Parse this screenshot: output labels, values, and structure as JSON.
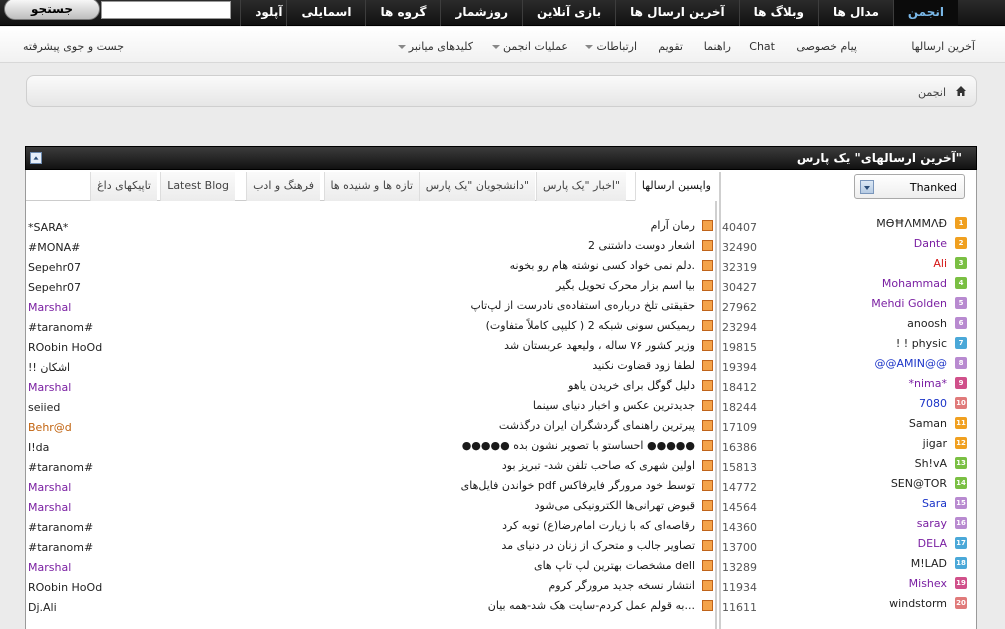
{
  "topbar": {
    "nav": [
      "انجمن",
      "مدال ها",
      "وبلاگ ها",
      "آخرین ارسال ها",
      "بازی آنلاین",
      "روزشمار",
      "گروه ها",
      "اسمایلی",
      "آپلود"
    ],
    "search_value": "",
    "search_button": "جستجو"
  },
  "subnav": {
    "latest_posts": "آخرین ارسالها",
    "private_message": "پیام خصوصی",
    "chat": "Chat",
    "help": "راهنما",
    "calendar": "تقویم",
    "connections": "ارتباطات",
    "forum_actions": "عملیات انجمن",
    "quick_links": "کلیدهای میانبر",
    "advanced_search": "جست و جوی پیشرفته"
  },
  "breadcrumb": {
    "home": "انجمن"
  },
  "widget": {
    "title": "آخرین ارسالهای\" یک پارس\"",
    "tabs": [
      "واپسین ارسالها",
      "اخبار \"یک پارس\"",
      "دانشجویان \"یک پارس\"",
      "تازه ها و شنیده ها",
      "فرهنگ و ادب",
      "Latest Blog",
      "تاپیکهای داغ"
    ],
    "dropdown_value": "Thanked"
  },
  "colors": {
    "purple_user": "#7a1fa2",
    "blue_user": "#1b34c8",
    "red_user": "#d41515",
    "orange_user": "#c1620e"
  },
  "threads": [
    {
      "title": "رمان آرام",
      "author": "*SARA*",
      "author_color": "#222"
    },
    {
      "title": "اشعار دوست داشتنی 2",
      "author": "#MONA#",
      "author_color": "#222"
    },
    {
      "title": "دلم نمی خواد کسی نوشته هام رو بخونه.",
      "author": "Sepehr07",
      "author_color": "#222"
    },
    {
      "title": "بیا اسم بزار محرک تحویل بگیر",
      "author": "Sepehr07",
      "author_color": "#222"
    },
    {
      "title": "حقیقتی تلخ درباره‌ی استفاده‌ی نادرست از لپ‌تاپ",
      "author": "Marshal",
      "author_color": "#7a1fa2"
    },
    {
      "title": "ریمیکس سونی شبکه 2 ( کلیپی کاملاً متفاوت)",
      "author": "#taranom#",
      "author_color": "#222"
    },
    {
      "title": "وزیر کشور ۷۶ ساله ، ولیعهد عربستان شد",
      "author": "ROobin HoOd",
      "author_color": "#222"
    },
    {
      "title": "لطفا زود قضاوت نکنید",
      "author": "!! اشکان",
      "author_color": "#222"
    },
    {
      "title": "دلیل گوگل برای خریدن یاهو",
      "author": "Marshal",
      "author_color": "#7a1fa2"
    },
    {
      "title": "جدیدترین عکس و اخبار دنیای سینما",
      "author": "seiied",
      "author_color": "#222"
    },
    {
      "title": "پیرترین راهنمای گردشگران ایران درگذشت",
      "author": "Behr@d",
      "author_color": "#c1620e"
    },
    {
      "title": "●●●●● احساستو با تصویر نشون بده ●●●●●",
      "author": "I!da",
      "author_color": "#222"
    },
    {
      "title": "اولین شهری که صاحب تلفن شد- تبریز بود",
      "author": "#taranom#",
      "author_color": "#222"
    },
    {
      "title": "خواندن فایل‌های pdf توسط خود مرورگر فایرفاکس",
      "author": "Marshal",
      "author_color": "#7a1fa2"
    },
    {
      "title": "قبوض تهرانی‌ها الکترونیکی می‌شود",
      "author": "Marshal",
      "author_color": "#7a1fa2"
    },
    {
      "title": "رقاصه‌ای که با زیارت امام‌رضا(ع) توبه کرد",
      "author": "#taranom#",
      "author_color": "#222"
    },
    {
      "title": "تصاویر جالب و متحرک از زنان در دنیای مد",
      "author": "#taranom#",
      "author_color": "#222"
    },
    {
      "title": "مشخصات بهترین لپ تاپ های dell",
      "author": "Marshal",
      "author_color": "#7a1fa2"
    },
    {
      "title": "انتشار نسخه جدید مرورگر کروم",
      "author": "ROobin HoOd",
      "author_color": "#222"
    },
    {
      "title": "به قولم عمل کردم-سایت هک شد-همه بیان...",
      "author": "Dj.Ali",
      "author_color": "#222"
    }
  ],
  "thanked_users": [
    {
      "rank": "1",
      "name": "MӨĦΛMMΛĐ",
      "count": "40407",
      "color": "#222",
      "badge": "#f0a020"
    },
    {
      "rank": "2",
      "name": "Dante",
      "count": "32490",
      "color": "#7a1fa2",
      "badge": "#f0a020"
    },
    {
      "rank": "3",
      "name": "Ali",
      "count": "32319",
      "color": "#d41515",
      "badge": "#7abf43"
    },
    {
      "rank": "4",
      "name": "Mohammad",
      "count": "30427",
      "color": "#7a1fa2",
      "badge": "#7abf43"
    },
    {
      "rank": "5",
      "name": "Mehdi Golden",
      "count": "27962",
      "color": "#7a1fa2",
      "badge": "#b88ad0"
    },
    {
      "rank": "6",
      "name": "anoosh",
      "count": "23294",
      "color": "#222",
      "badge": "#b88ad0"
    },
    {
      "rank": "7",
      "name": "! ! physic",
      "count": "19815",
      "color": "#222",
      "badge": "#4aa8d8"
    },
    {
      "rank": "8",
      "name": "@@AMIN@@",
      "count": "19394",
      "color": "#1b34c8",
      "badge": "#b88ad0"
    },
    {
      "rank": "9",
      "name": "*nima*",
      "count": "18412",
      "color": "#7a1fa2",
      "badge": "#d0508a"
    },
    {
      "rank": "10",
      "name": "7080",
      "count": "18244",
      "color": "#1b34c8",
      "badge": "#e07a7a"
    },
    {
      "rank": "11",
      "name": "Saman",
      "count": "17109",
      "color": "#222",
      "badge": "#f0a020"
    },
    {
      "rank": "12",
      "name": "jigar",
      "count": "16386",
      "color": "#222",
      "badge": "#f0a020"
    },
    {
      "rank": "13",
      "name": "Sh!vA",
      "count": "15813",
      "color": "#222",
      "badge": "#7abf43"
    },
    {
      "rank": "14",
      "name": "SEN@TOR",
      "count": "14772",
      "color": "#222",
      "badge": "#7abf43"
    },
    {
      "rank": "15",
      "name": "Sara",
      "count": "14564",
      "color": "#1b34c8",
      "badge": "#b88ad0"
    },
    {
      "rank": "16",
      "name": "saray",
      "count": "14360",
      "color": "#7a1fa2",
      "badge": "#b88ad0"
    },
    {
      "rank": "17",
      "name": "DELA",
      "count": "13700",
      "color": "#7a1fa2",
      "badge": "#4aa8d8"
    },
    {
      "rank": "18",
      "name": "M!LAD",
      "count": "13289",
      "color": "#222",
      "badge": "#4aa8d8"
    },
    {
      "rank": "19",
      "name": "Mishex",
      "count": "11934",
      "color": "#7a1fa2",
      "badge": "#d0508a"
    },
    {
      "rank": "20",
      "name": "windstorm",
      "count": "11611",
      "color": "#222",
      "badge": "#e07a7a"
    }
  ]
}
